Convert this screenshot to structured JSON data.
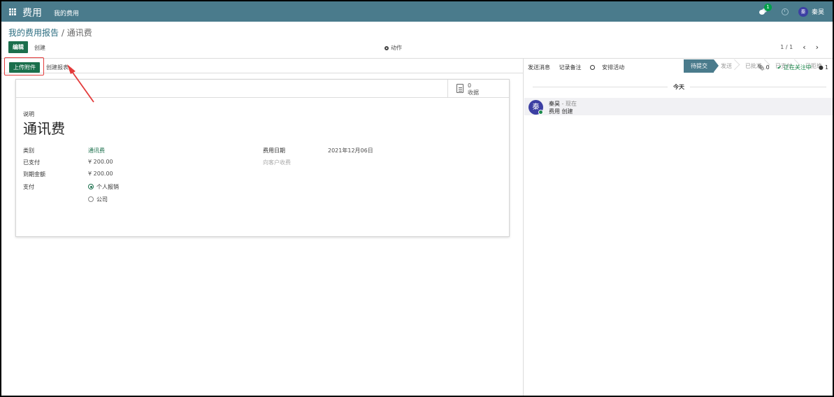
{
  "navbar": {
    "app_name": "费用",
    "menu_item": "我的费用",
    "message_badge": "1",
    "user_initial": "秦",
    "user_name": "秦昊"
  },
  "breadcrumb": {
    "parent": "我的费用报告",
    "separator": " / ",
    "current": "通讯费"
  },
  "control": {
    "edit_label": "编辑",
    "create_label": "创建",
    "action_label": "动作",
    "pager": "1 / 1",
    "prev": "‹",
    "next": "›"
  },
  "statusbar": {
    "upload_label": "上传附件",
    "create_report_label": "创建报表",
    "stages": [
      "待提交",
      "发送",
      "已批准",
      "已支付",
      "已拒绝"
    ],
    "active_stage": "待提交"
  },
  "sheet": {
    "receipts_count": "0",
    "receipts_label": "收据",
    "description_label": "说明",
    "title": "通讯费",
    "category_label": "类别",
    "category_value": "通讯费",
    "paid_label": "已支付",
    "paid_value": "¥ 200.00",
    "due_label": "到期金额",
    "due_value": "¥ 200.00",
    "payment_label": "支付",
    "payment_options": [
      "个人报销",
      "公司"
    ],
    "payment_selected": "个人报销",
    "date_label": "费用日期",
    "date_value": "2021年12月06日",
    "rebill_placeholder": "向客户收费"
  },
  "chatter": {
    "send_message": "发送消息",
    "log_note": "记录备注",
    "schedule_activity": "安排活动",
    "attachments_count": "0",
    "following_label": "正在关注中",
    "followers_count": "1",
    "today_label": "今天",
    "message": {
      "author_initial": "秦",
      "author": "秦昊",
      "time": " - 现在",
      "body": "费用 创建"
    }
  },
  "colors": {
    "navbar": "#4a7b8c",
    "primary_button": "#1b6f4c",
    "annotation": "#e33b3b"
  }
}
